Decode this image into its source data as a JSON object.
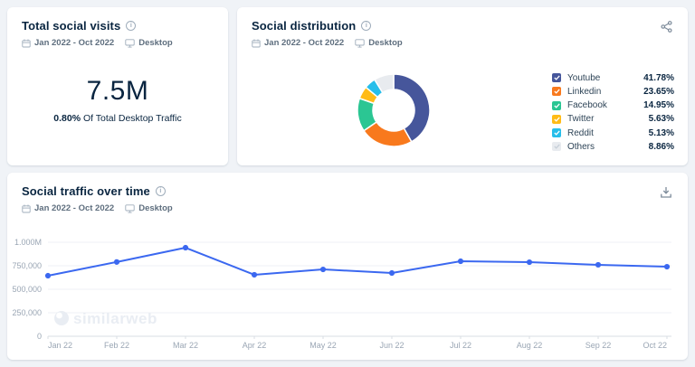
{
  "page": {
    "background": "#F0F3F7",
    "watermark": "similarweb"
  },
  "cards": {
    "total_visits": {
      "title": "Total social visits",
      "date_range": "Jan 2022 - Oct 2022",
      "device": "Desktop",
      "value": "7.5M",
      "share_bold": "0.80%",
      "share_rest": "Of Total Desktop Traffic"
    },
    "distribution": {
      "title": "Social distribution",
      "date_range": "Jan 2022 - Oct 2022",
      "device": "Desktop"
    },
    "traffic": {
      "title": "Social traffic over time",
      "date_range": "Jan 2022 - Oct 2022",
      "device": "Desktop"
    }
  },
  "chart_data": [
    {
      "type": "pie",
      "variant": "donut",
      "title": "Social distribution",
      "legend_position": "right",
      "value_format": "percent",
      "segments": [
        {
          "label": "Youtube",
          "value": 41.78,
          "color": "#46569B"
        },
        {
          "label": "Linkedin",
          "value": 23.65,
          "color": "#F8791D"
        },
        {
          "label": "Facebook",
          "value": 14.95,
          "color": "#2BC693"
        },
        {
          "label": "Twitter",
          "value": 5.63,
          "color": "#FFBB17"
        },
        {
          "label": "Reddit",
          "value": 5.13,
          "color": "#27BEEA"
        },
        {
          "label": "Others",
          "value": 8.86,
          "color": "#E8EBEF"
        }
      ]
    },
    {
      "type": "line",
      "title": "Social traffic over time",
      "x": [
        "Jan 22",
        "Feb 22",
        "Mar 22",
        "Apr 22",
        "May 22",
        "Jun 22",
        "Jul 22",
        "Aug 22",
        "Sep 22",
        "Oct 22"
      ],
      "values": [
        644000,
        790000,
        942000,
        654000,
        711000,
        673000,
        798000,
        788000,
        760000,
        740000
      ],
      "ylim": [
        0,
        1000000
      ],
      "yticks": [
        {
          "v": 1000000,
          "label": "1.000M"
        },
        {
          "v": 750000,
          "label": "750,000"
        },
        {
          "v": 500000,
          "label": "500,000"
        },
        {
          "v": 250000,
          "label": "250,000"
        },
        {
          "v": 0,
          "label": "0"
        }
      ],
      "line_color": "#3B68F0",
      "grid": true,
      "legend": "none"
    }
  ]
}
